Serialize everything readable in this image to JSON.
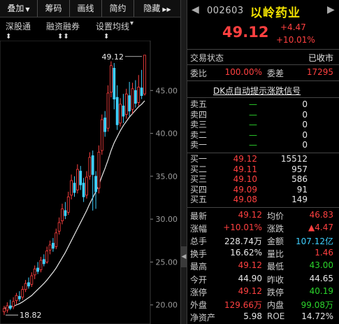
{
  "toolbar": {
    "buttons": [
      {
        "label": "叠加",
        "suffix": "▼"
      },
      {
        "label": "筹码"
      },
      {
        "label": "画线"
      },
      {
        "label": "简约"
      },
      {
        "label": "隐藏",
        "suffix": "▶▶"
      }
    ]
  },
  "subbar": {
    "items": [
      "深股通",
      "融资融券",
      "设置均线",
      "▾"
    ],
    "arrows": [
      "⬍",
      "⬍⬍",
      "⬍"
    ]
  },
  "chart_data": {
    "type": "candlestick",
    "y_ticks": [
      "45.00",
      "40.00",
      "35.00",
      "30.00",
      "25.00",
      "20.00"
    ],
    "y_range": [
      19,
      50
    ],
    "high_label": "49.12",
    "low_label": "18.82",
    "candles": [
      {
        "o": 19.2,
        "c": 19.6,
        "h": 19.9,
        "l": 18.82
      },
      {
        "o": 19.4,
        "c": 19.9,
        "h": 20.3,
        "l": 19.1
      },
      {
        "o": 19.9,
        "c": 19.6,
        "h": 20.6,
        "l": 19.4
      },
      {
        "o": 19.8,
        "c": 20.4,
        "h": 20.9,
        "l": 19.5
      },
      {
        "o": 20.5,
        "c": 21.1,
        "h": 21.4,
        "l": 20.1
      },
      {
        "o": 21.0,
        "c": 20.7,
        "h": 21.6,
        "l": 20.4
      },
      {
        "o": 20.9,
        "c": 21.8,
        "h": 22.2,
        "l": 20.6
      },
      {
        "o": 21.8,
        "c": 22.5,
        "h": 22.9,
        "l": 21.5
      },
      {
        "o": 22.6,
        "c": 22.2,
        "h": 23.2,
        "l": 21.9
      },
      {
        "o": 22.4,
        "c": 23.4,
        "h": 23.8,
        "l": 22.1
      },
      {
        "o": 23.5,
        "c": 24.2,
        "h": 24.6,
        "l": 23.0
      },
      {
        "o": 24.3,
        "c": 23.9,
        "h": 25.0,
        "l": 23.6
      },
      {
        "o": 24.1,
        "c": 25.2,
        "h": 25.6,
        "l": 23.8
      },
      {
        "o": 25.3,
        "c": 24.8,
        "h": 25.9,
        "l": 24.5
      },
      {
        "o": 25.0,
        "c": 26.3,
        "h": 26.8,
        "l": 24.8
      },
      {
        "o": 26.4,
        "c": 27.0,
        "h": 27.5,
        "l": 25.9
      },
      {
        "o": 27.2,
        "c": 26.6,
        "h": 27.8,
        "l": 26.2
      },
      {
        "o": 26.8,
        "c": 28.4,
        "h": 28.9,
        "l": 26.5
      },
      {
        "o": 28.6,
        "c": 29.6,
        "h": 30.2,
        "l": 28.2
      },
      {
        "o": 29.8,
        "c": 31.2,
        "h": 31.8,
        "l": 29.4
      },
      {
        "o": 31.0,
        "c": 30.4,
        "h": 32.0,
        "l": 30.0
      },
      {
        "o": 30.8,
        "c": 32.6,
        "h": 33.2,
        "l": 30.5
      },
      {
        "o": 32.8,
        "c": 34.5,
        "h": 35.2,
        "l": 32.3
      },
      {
        "o": 34.2,
        "c": 33.1,
        "h": 35.0,
        "l": 32.6
      },
      {
        "o": 33.4,
        "c": 35.8,
        "h": 36.4,
        "l": 33.0
      },
      {
        "o": 35.6,
        "c": 34.0,
        "h": 36.2,
        "l": 33.4
      },
      {
        "o": 34.2,
        "c": 32.6,
        "h": 34.8,
        "l": 32.0
      },
      {
        "o": 32.8,
        "c": 34.9,
        "h": 35.6,
        "l": 32.4
      },
      {
        "o": 35.0,
        "c": 37.2,
        "h": 37.8,
        "l": 34.6
      },
      {
        "o": 37.4,
        "c": 35.2,
        "h": 38.0,
        "l": 31.0
      },
      {
        "o": 35.0,
        "c": 33.2,
        "h": 35.6,
        "l": 31.2
      },
      {
        "o": 33.6,
        "c": 37.8,
        "h": 38.6,
        "l": 33.0
      },
      {
        "o": 38.0,
        "c": 41.6,
        "h": 42.2,
        "l": 37.5
      },
      {
        "o": 41.8,
        "c": 40.2,
        "h": 42.6,
        "l": 39.6
      },
      {
        "o": 40.6,
        "c": 44.7,
        "h": 45.6,
        "l": 40.2
      },
      {
        "o": 44.8,
        "c": 47.9,
        "h": 48.4,
        "l": 44.2
      },
      {
        "o": 47.6,
        "c": 44.0,
        "h": 48.2,
        "l": 42.8
      },
      {
        "o": 44.2,
        "c": 41.0,
        "h": 45.6,
        "l": 40.4
      },
      {
        "o": 41.2,
        "c": 43.4,
        "h": 44.1,
        "l": 40.8
      },
      {
        "o": 43.2,
        "c": 42.0,
        "h": 44.6,
        "l": 41.2
      },
      {
        "o": 42.2,
        "c": 44.6,
        "h": 45.2,
        "l": 41.7
      },
      {
        "o": 44.4,
        "c": 42.6,
        "h": 46.0,
        "l": 42.0
      },
      {
        "o": 42.8,
        "c": 45.2,
        "h": 45.9,
        "l": 42.3
      },
      {
        "o": 45.0,
        "c": 43.5,
        "h": 46.2,
        "l": 43.0
      },
      {
        "o": 43.6,
        "c": 45.4,
        "h": 46.8,
        "l": 43.2
      },
      {
        "o": 45.3,
        "c": 44.4,
        "h": 47.4,
        "l": 44.0
      },
      {
        "o": 44.6,
        "c": 49.12,
        "h": 49.12,
        "l": 44.4
      }
    ],
    "ma": [
      19.6,
      19.7,
      19.75,
      19.85,
      20.0,
      20.15,
      20.35,
      20.6,
      20.85,
      21.1,
      21.45,
      21.8,
      22.15,
      22.5,
      22.9,
      23.35,
      23.8,
      24.3,
      24.9,
      25.5,
      26.1,
      26.8,
      27.5,
      28.2,
      28.9,
      29.6,
      30.3,
      31.0,
      31.8,
      32.5,
      33.2,
      34.0,
      35.0,
      35.9,
      36.9,
      38.0,
      38.9,
      39.6,
      40.3,
      40.9,
      41.4,
      41.9,
      42.3,
      42.7,
      43.1,
      43.4,
      43.8
    ]
  },
  "quote": {
    "nav_left": "◀",
    "nav_right": "▶",
    "code": "002603",
    "name": "以岭药业",
    "price": "49.12",
    "change": "+4.47",
    "change_pct": "+10.01%",
    "status_label": "交易状态",
    "status_value": "已收市",
    "weibi_label": "委比",
    "weibi_value": "100.00%",
    "weicha_label": "委差",
    "weicha_value": "17295",
    "dk_link": "DK点自动提示涨跌信号",
    "asks": [
      {
        "label": "卖五",
        "price": "—",
        "vol": "0"
      },
      {
        "label": "卖四",
        "price": "—",
        "vol": "0"
      },
      {
        "label": "卖三",
        "price": "—",
        "vol": "0"
      },
      {
        "label": "卖二",
        "price": "—",
        "vol": "0"
      },
      {
        "label": "卖一",
        "price": "—",
        "vol": "0"
      }
    ],
    "bids": [
      {
        "label": "买一",
        "price": "49.12",
        "vol": "15512"
      },
      {
        "label": "买二",
        "price": "49.11",
        "vol": "957"
      },
      {
        "label": "买三",
        "price": "49.10",
        "vol": "586"
      },
      {
        "label": "买四",
        "price": "49.09",
        "vol": "91"
      },
      {
        "label": "买五",
        "price": "49.08",
        "vol": "149"
      }
    ],
    "stats": [
      {
        "l1": "最新",
        "v1": "49.12",
        "c1": "red",
        "l2": "均价",
        "v2": "46.83",
        "c2": "red"
      },
      {
        "l1": "涨幅",
        "v1": "+10.01%",
        "c1": "red",
        "l2": "涨跌",
        "v2": "▲4.47",
        "c2": "red"
      },
      {
        "l1": "总手",
        "v1": "228.74万",
        "c1": "white",
        "l2": "金额",
        "v2": "107.12亿",
        "c2": "cyan"
      },
      {
        "l1": "换手",
        "v1": "16.62%",
        "c1": "white",
        "l2": "量比",
        "v2": "1.46",
        "c2": "red"
      },
      {
        "l1": "最高",
        "v1": "49.12",
        "c1": "red",
        "l2": "最低",
        "v2": "43.00",
        "c2": "green"
      },
      {
        "l1": "今开",
        "v1": "44.90",
        "c1": "white",
        "l2": "昨收",
        "v2": "44.65",
        "c2": "white"
      },
      {
        "l1": "涨停",
        "v1": "49.12",
        "c1": "red",
        "l2": "跌停",
        "v2": "40.19",
        "c2": "green"
      },
      {
        "l1": "外盘",
        "v1": "129.66万",
        "c1": "red",
        "l2": "内盘",
        "v2": "99.08万",
        "c2": "green"
      },
      {
        "l1": "净资产",
        "v1": "5.98",
        "c1": "white",
        "l2": "ROE",
        "v2": "14.72%",
        "c2": "white"
      }
    ]
  },
  "colors": {
    "up": "#ff4040",
    "down": "#3fd0ff",
    "ma": "#e8e8e8",
    "accent_yellow": "#f0e000",
    "green": "#2bd52b"
  }
}
